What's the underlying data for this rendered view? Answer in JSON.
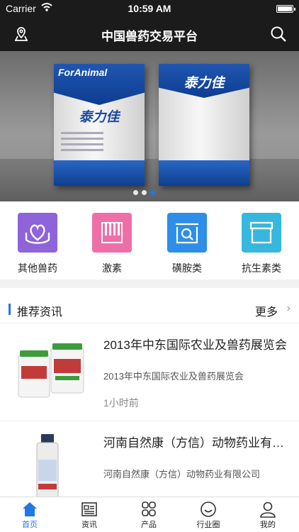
{
  "status_bar": {
    "carrier": "Carrier",
    "time": "10:59 AM",
    "battery_level": 1.0
  },
  "header": {
    "title": "中国兽药交易平台",
    "left_icon": "location-icon",
    "right_icon": "search-icon"
  },
  "banner": {
    "products": [
      {
        "brand": "ForAnimal",
        "name": "泰力佳"
      },
      {
        "brand": "",
        "name": "泰力佳"
      }
    ],
    "page_count": 3,
    "active_page": 3
  },
  "categories": [
    {
      "label": "其他兽药",
      "color": "#8f63d9",
      "icon": "heart-hand-icon"
    },
    {
      "label": "激素",
      "color": "#ee6fa8",
      "icon": "bars-icon"
    },
    {
      "label": "磺胺类",
      "color": "#2e8ee8",
      "icon": "search-box-icon"
    },
    {
      "label": "抗生素类",
      "color": "#36b8de",
      "icon": "box-icon"
    }
  ],
  "recommended": {
    "heading": "推荐资讯",
    "more_label": "更多",
    "items": [
      {
        "title": "2013年中东国际农业及兽药展览会",
        "description": "2013年中东国际农业及兽药展览会",
        "time": "1小时前"
      },
      {
        "title": "河南自然康（方信）动物药业有限公司",
        "description": "河南自然康（方信）动物药业有限公司",
        "time": ""
      }
    ]
  },
  "tabbar": {
    "tabs": [
      {
        "label": "首页",
        "icon": "home-icon",
        "active": true
      },
      {
        "label": "资讯",
        "icon": "news-icon",
        "active": false
      },
      {
        "label": "产品",
        "icon": "grid-icon",
        "active": false
      },
      {
        "label": "行业圈",
        "icon": "smile-icon",
        "active": false
      },
      {
        "label": "我的",
        "icon": "user-icon",
        "active": false
      }
    ]
  },
  "colors": {
    "accent": "#1f78e6",
    "bar": "#1b1b1b"
  }
}
